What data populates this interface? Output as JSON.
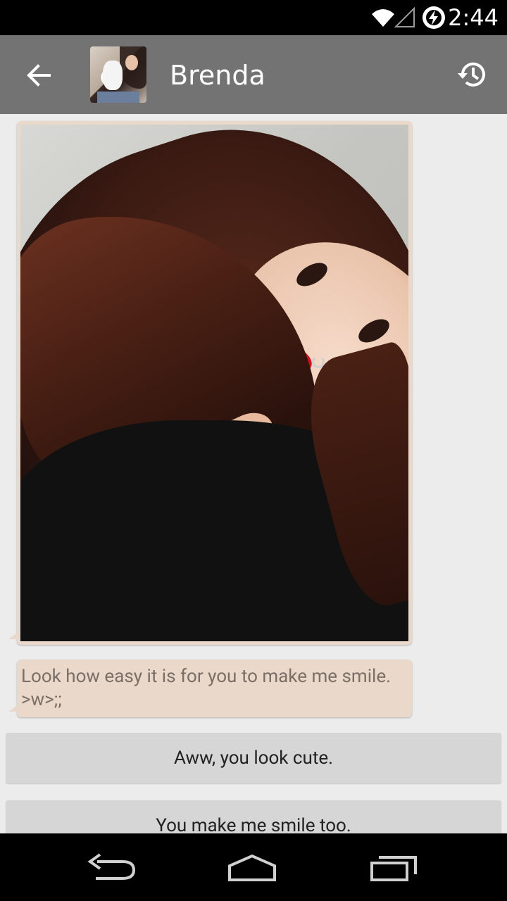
{
  "status_bar": {
    "time": "2:44",
    "icons": [
      "wifi-icon",
      "signal-icon",
      "charging-icon"
    ]
  },
  "action_bar": {
    "title": "Brenda",
    "back_icon": "arrow-left-icon",
    "history_icon": "history-icon",
    "background_color": "#737373"
  },
  "conversation": {
    "messages": [
      {
        "type": "image",
        "alt": "selfie-photo"
      },
      {
        "type": "text",
        "text": "Look how easy it is for you to make me smile. >w>;;"
      }
    ],
    "bubble_color": "#ead9cb"
  },
  "replies": [
    {
      "label": "Aww, you look cute."
    },
    {
      "label": "You make me smile too."
    }
  ],
  "nav_bar": {
    "icons": [
      "back-nav-icon",
      "home-nav-icon",
      "recents-nav-icon"
    ]
  }
}
